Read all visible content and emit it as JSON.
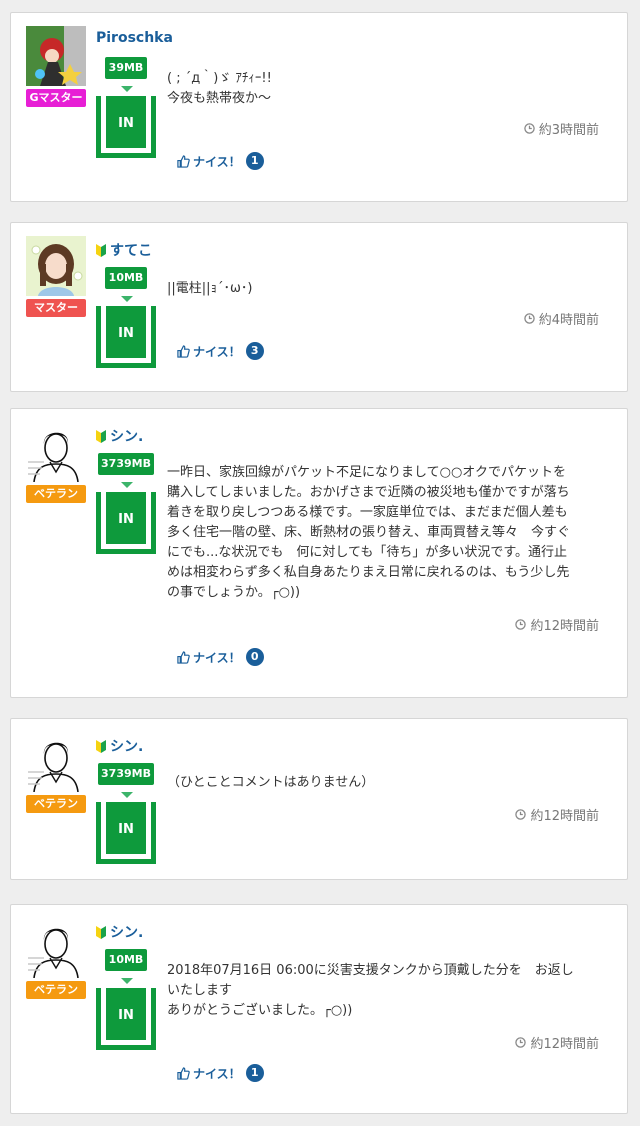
{
  "posts": [
    {
      "username": "Piroschka",
      "beginner": false,
      "badge": "Gマスター",
      "badge_color": "#e71fd5",
      "tank_mb": "39MB",
      "tank_label": "IN",
      "comment": "( ; ´д｀)ゞ ｱﾁｨｰ!!\n今夜も熱帯夜か〜",
      "time": "約3時間前",
      "nice_label": "ナイス！",
      "nice_count": "1"
    },
    {
      "username": "すてこ",
      "beginner": true,
      "badge": "マスター",
      "badge_color": "#ef5350",
      "tank_mb": "10MB",
      "tank_label": "IN",
      "comment": "||電柱||ｮ´･ω･)",
      "time": "約4時間前",
      "nice_label": "ナイス！",
      "nice_count": "3"
    },
    {
      "username": "シン.",
      "beginner": true,
      "badge": "ベテラン",
      "badge_color": "#f59a10",
      "tank_mb": "3739MB",
      "tank_label": "IN",
      "comment": "一昨日、家族回線がパケット不足になりまして○○オクでパケットを\n購入してしまいました。おかげさまで近隣の被災地も僅かですが落ち\n着きを取り戻しつつある様です。一家庭単位では、まだまだ個人差も\n多く住宅一階の壁、床、断熱材の張り替え、車両買替え等々　今すぐ\nにでも...な状況でも　何に対しても「待ち」が多い状況です。通行止\nめは相変わらず多く私自身あたりまえ日常に戻れるのは、もう少し先\nの事でしょうか。┌○))",
      "time": "約12時間前",
      "nice_label": "ナイス！",
      "nice_count": "0"
    },
    {
      "username": "シン.",
      "beginner": true,
      "badge": "ベテラン",
      "badge_color": "#f59a10",
      "tank_mb": "3739MB",
      "tank_label": "IN",
      "comment": "（ひとことコメントはありません）",
      "time": "約12時間前"
    },
    {
      "username": "シン.",
      "beginner": true,
      "badge": "ベテラン",
      "badge_color": "#f59a10",
      "tank_mb": "10MB",
      "tank_label": "IN",
      "comment": "2018年07月16日 06:00に災害支援タンクから頂戴した分を　お返し\nいたします\nありがとうございました。┌○))",
      "time": "約12時間前",
      "nice_label": "ナイス！",
      "nice_count": "1"
    }
  ]
}
